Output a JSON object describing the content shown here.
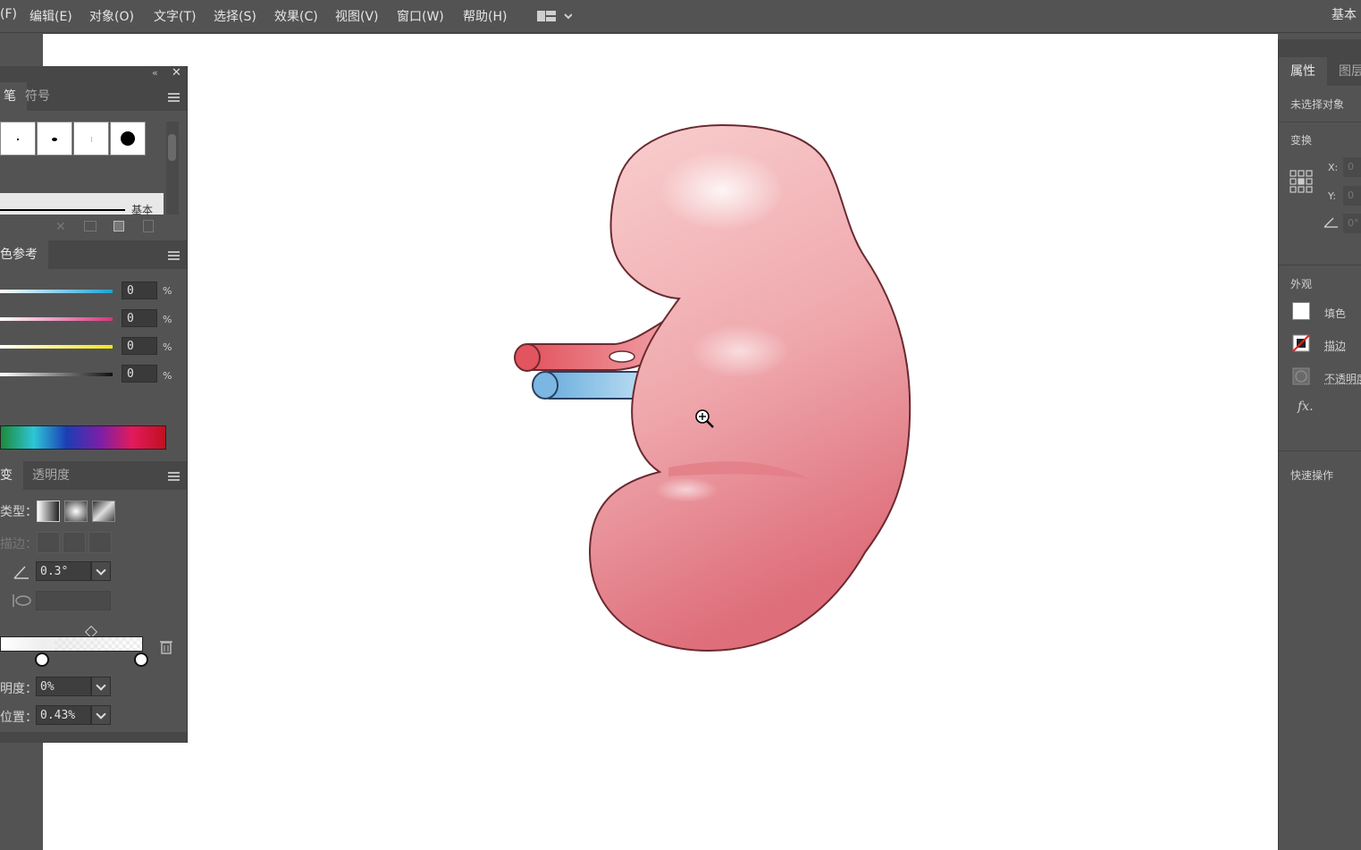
{
  "menubar": {
    "items": [
      "(F)",
      "编辑(E)",
      "对象(O)",
      "文字(T)",
      "选择(S)",
      "效果(C)",
      "视图(V)",
      "窗口(W)",
      "帮助(H)"
    ],
    "workspace": "基本"
  },
  "brushes_panel": {
    "tabs": [
      "笔",
      "符号"
    ],
    "basic_label": "基本"
  },
  "color_guide": {
    "tab": "色参考",
    "values": [
      "0",
      "0",
      "0",
      "0"
    ],
    "unit": "%"
  },
  "gradient_panel": {
    "tabs": [
      "变",
      "透明度"
    ],
    "type_label": "类型：",
    "stroke_label": "描边：",
    "angle_value": "0.3°",
    "opacity_label": "明度：",
    "opacity_value": "0%",
    "location_label": "位置：",
    "location_value": "0.43%"
  },
  "properties_panel": {
    "tabs": [
      "属性",
      "图层"
    ],
    "no_selection": "未选择对象",
    "transform": "变换",
    "x_label": "X:",
    "y_label": "Y:",
    "x_value": "0",
    "y_value": "0",
    "angle_value": "0°",
    "appearance": "外观",
    "fill": "填色",
    "stroke": "描边",
    "opacity": "不透明度",
    "fx": "fx.",
    "quick_actions": "快速操作"
  },
  "colors": {
    "artery": "#e0505a",
    "vein": "#6aaedc",
    "kidney_light": "#f8c8c8",
    "kidney_dark": "#de6e78",
    "outline": "#6a2a30"
  }
}
